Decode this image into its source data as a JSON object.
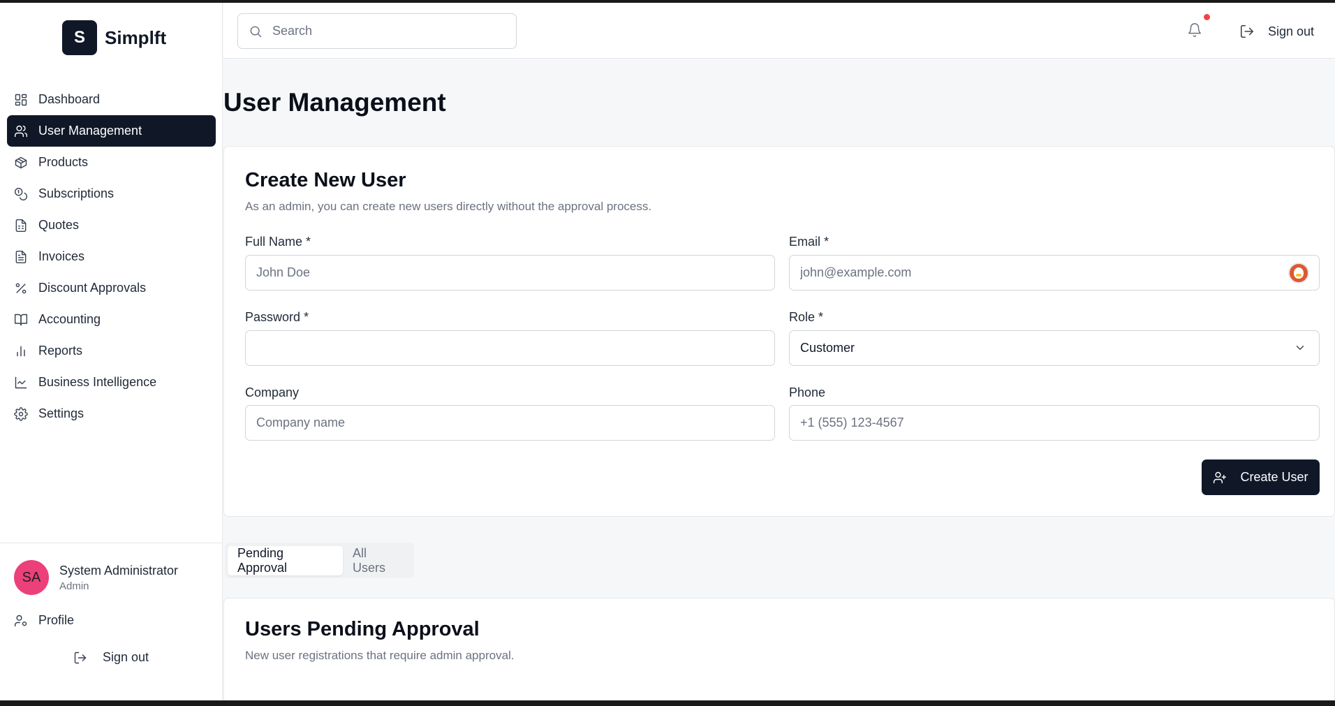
{
  "brand": {
    "logo_letter": "S",
    "name": "Simplft"
  },
  "sidebar": {
    "items": [
      {
        "label": "Dashboard",
        "icon": "dashboard-icon",
        "active": false
      },
      {
        "label": "User Management",
        "icon": "users-icon",
        "active": true
      },
      {
        "label": "Products",
        "icon": "package-icon",
        "active": false
      },
      {
        "label": "Subscriptions",
        "icon": "coins-icon",
        "active": false
      },
      {
        "label": "Quotes",
        "icon": "calculator-icon",
        "active": false
      },
      {
        "label": "Invoices",
        "icon": "file-text-icon",
        "active": false
      },
      {
        "label": "Discount Approvals",
        "icon": "percent-icon",
        "active": false
      },
      {
        "label": "Accounting",
        "icon": "book-open-icon",
        "active": false
      },
      {
        "label": "Reports",
        "icon": "bar-chart-icon",
        "active": false
      },
      {
        "label": "Business Intelligence",
        "icon": "line-chart-icon",
        "active": false
      },
      {
        "label": "Settings",
        "icon": "gear-icon",
        "active": false
      }
    ],
    "user": {
      "initials": "SA",
      "name": "System Administrator",
      "role": "Admin"
    },
    "profile_label": "Profile",
    "signout_label": "Sign out"
  },
  "topbar": {
    "search_placeholder": "Search",
    "signout_label": "Sign out",
    "has_notification": true
  },
  "page": {
    "title": "User Management"
  },
  "create_user": {
    "title": "Create New User",
    "subtitle": "As an admin, you can create new users directly without the approval process.",
    "fields": {
      "full_name": {
        "label": "Full Name *",
        "placeholder": "John Doe",
        "value": ""
      },
      "email": {
        "label": "Email *",
        "placeholder": "john@example.com",
        "value": ""
      },
      "password": {
        "label": "Password *",
        "placeholder": "",
        "value": ""
      },
      "role": {
        "label": "Role *",
        "value": "Customer"
      },
      "company": {
        "label": "Company",
        "placeholder": "Company name",
        "value": ""
      },
      "phone": {
        "label": "Phone",
        "placeholder": "+1 (555) 123-4567",
        "value": ""
      }
    },
    "submit_label": "Create User"
  },
  "tabs": [
    {
      "label": "Pending Approval",
      "active": true
    },
    {
      "label": "All Users",
      "active": false
    }
  ],
  "pending": {
    "title": "Users Pending Approval",
    "subtitle": "New user registrations that require admin approval."
  },
  "colors": {
    "primary": "#101828",
    "notification_dot": "#ef4444",
    "avatar_bg": "#ec407a",
    "background": "#f6f7f9"
  }
}
